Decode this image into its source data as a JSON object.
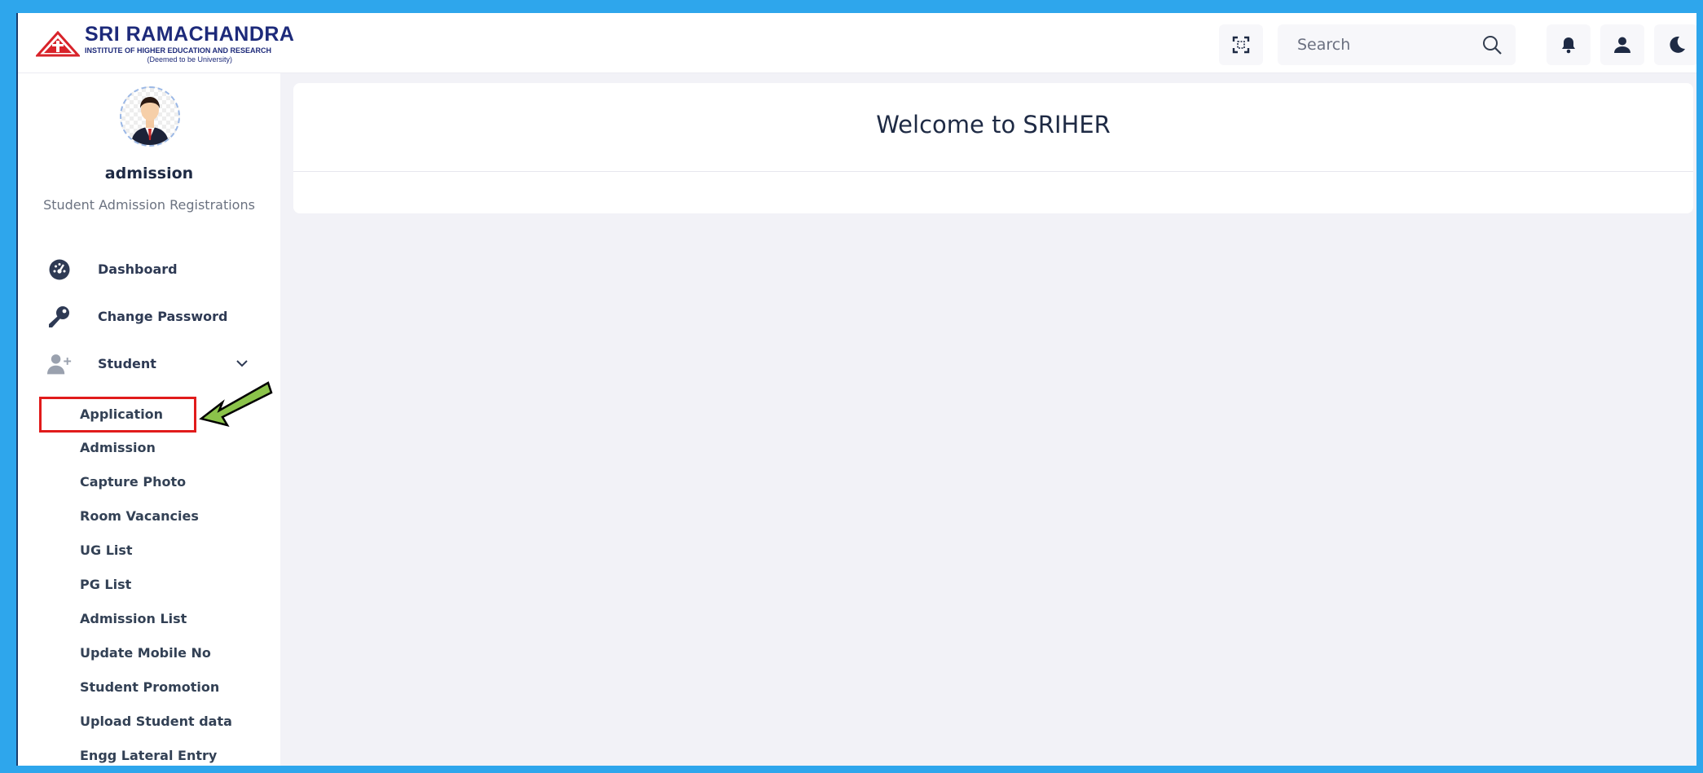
{
  "brand": {
    "title": "SRI RAMACHANDRA",
    "subtitle": "INSTITUTE OF HIGHER EDUCATION AND RESEARCH",
    "tagline": "(Deemed to be University)",
    "color": "#1d2a7a",
    "accent": "#d8232a"
  },
  "topbar": {
    "search_placeholder": "Search",
    "icons": [
      "fullscreen-icon",
      "search-icon",
      "bell-icon",
      "user-icon",
      "moon-icon"
    ]
  },
  "profile": {
    "name": "admission",
    "role": "Student Admission Registrations"
  },
  "menu": {
    "items": [
      {
        "label": "Dashboard",
        "icon": "dashboard-icon"
      },
      {
        "label": "Change Password",
        "icon": "key-icon"
      },
      {
        "label": "Student",
        "icon": "user-plus-icon",
        "expanded": true
      }
    ],
    "student_sub": [
      "Application",
      "Admission",
      "Capture Photo",
      "Room Vacancies",
      "UG List",
      "PG List",
      "Admission List",
      "Update Mobile No",
      "Student Promotion",
      "Upload Student data",
      "Engg Lateral Entry"
    ]
  },
  "annotation": {
    "highlighted_item": "Application",
    "box_color": "#e11b1b",
    "arrow_color": "#8bc34a"
  },
  "main": {
    "welcome": "Welcome to SRIHER"
  }
}
